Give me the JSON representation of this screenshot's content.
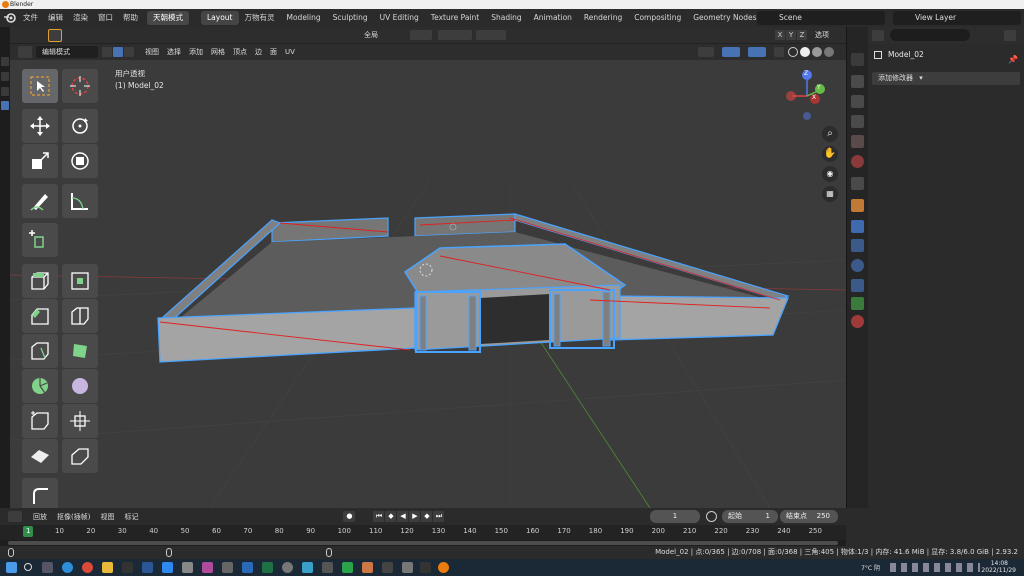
{
  "window": {
    "title": "Blender"
  },
  "menu": [
    "文件",
    "编辑",
    "渲染",
    "窗口",
    "帮助"
  ],
  "workspaces": [
    "天朝模式",
    "Layout",
    "万物有灵",
    "Modeling",
    "Sculpting",
    "UV Editing",
    "Texture Paint",
    "Shading",
    "Animation",
    "Rendering",
    "Compositing",
    "Geometry Nodes"
  ],
  "active_workspace": "Layout",
  "scene": {
    "label": "Scene",
    "view_layer": "View Layer"
  },
  "tool_header": {
    "transform_space": "全局",
    "options": "选项",
    "axes": [
      "X",
      "Y",
      "Z"
    ]
  },
  "viewport_header": {
    "mode": "编辑模式",
    "menus": [
      "视图",
      "选择",
      "添加",
      "网格",
      "顶点",
      "边",
      "面",
      "UV"
    ]
  },
  "viewport": {
    "view_name": "用户透视",
    "object_label": "(1) Model_02"
  },
  "gizmo": {
    "axes": [
      "X",
      "Y",
      "Z"
    ]
  },
  "properties": {
    "object_name": "Model_02",
    "add_modifier": "添加修改器"
  },
  "timeline": {
    "menus": [
      "回放",
      "抠像(插帧)",
      "视图",
      "标记"
    ],
    "current_frame": "1",
    "start_label": "起始",
    "start": "1",
    "end_label": "结束点",
    "end": "250",
    "ruler": [
      "1",
      "10",
      "20",
      "30",
      "40",
      "50",
      "60",
      "70",
      "80",
      "90",
      "100",
      "110",
      "120",
      "130",
      "140",
      "150",
      "160",
      "170",
      "180",
      "190",
      "200",
      "210",
      "220",
      "230",
      "240",
      "250"
    ]
  },
  "status": {
    "text": "Model_02 | 点:0/365 | 边:0/708 | 面:0/368 | 三角:405 | 物体:1/3 | 内存: 41.6 MiB | 显存: 3.8/6.0 GiB | 2.93.2"
  },
  "taskbar": {
    "temperature": "7°C 阴",
    "time": "14:08",
    "date": "2022/11/29"
  }
}
